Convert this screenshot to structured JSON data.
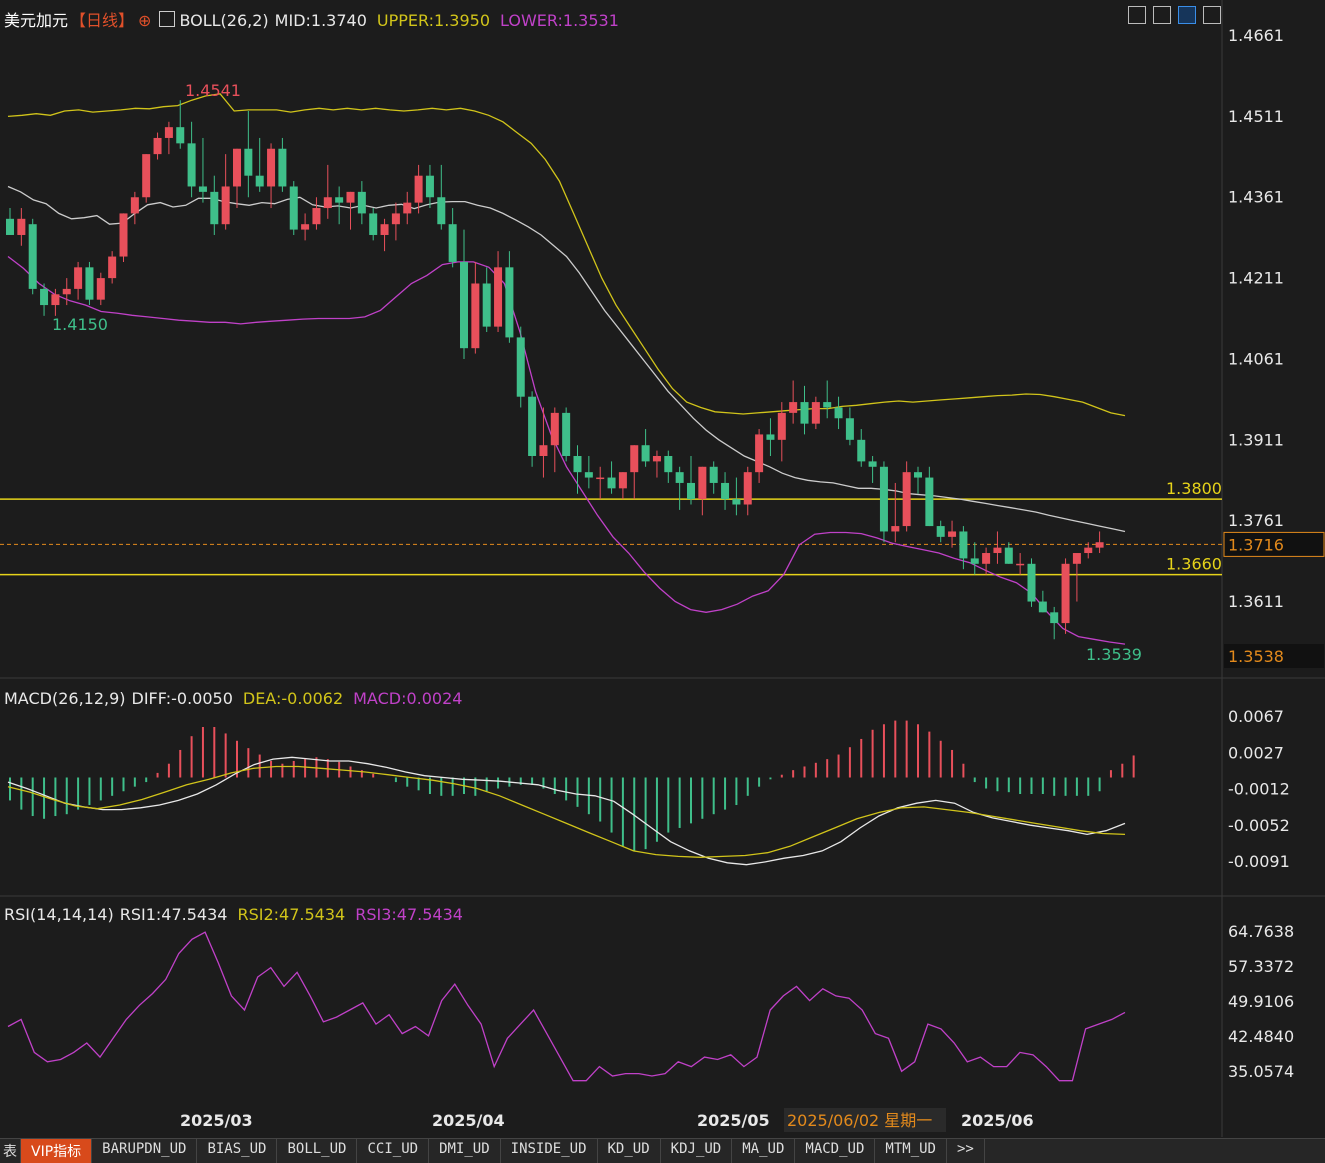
{
  "header": {
    "instrument": "美元加元",
    "period": "【日线】",
    "boll": "BOLL(26,2)",
    "mid": "MID:1.3740",
    "upper": "UPPER:1.3950",
    "lower": "LOWER:1.3531"
  },
  "toolbar_icons": [
    "crosshair-icon",
    "layout-icon",
    "play-icon",
    "forward-icon"
  ],
  "macd_header": {
    "name": "MACD(26,12,9)",
    "diff": "DIFF:-0.0050",
    "dea": "DEA:-0.0062",
    "macd": "MACD:0.0024"
  },
  "rsi_header": {
    "name": "RSI(14,14,14)",
    "rsi1": "RSI1:47.5434",
    "rsi2": "RSI2:47.5434",
    "rsi3": "RSI3:47.5434"
  },
  "colors": {
    "up": "#e8505b",
    "down": "#3fbf8a",
    "mid": "#cccccc",
    "upper": "#d1c41a",
    "lower": "#c041c8",
    "hline": "#e6d31a",
    "price_dash": "#e38a1c",
    "bg": "#1c1c1c"
  },
  "main_axis": {
    "ylim": [
      1.3538,
      1.4661
    ],
    "ticks": [
      "1.4661",
      "1.4511",
      "1.4361",
      "1.4211",
      "1.4061",
      "1.3911",
      "1.3761",
      "1.3611"
    ]
  },
  "macd_axis": {
    "ylim": [
      -0.0091,
      0.0067
    ],
    "ticks": [
      "0.0067",
      "0.0027",
      "-0.0012",
      "-0.0052",
      "-0.0091"
    ]
  },
  "rsi_axis": {
    "ylim": [
      35.0574,
      64.7638
    ],
    "ticks": [
      "64.7638",
      "57.3372",
      "49.9106",
      "42.4840",
      "35.0574"
    ]
  },
  "x_labels": [
    "2025/03",
    "2025/04",
    "2025/05",
    "2025/06"
  ],
  "cursor_date": "2025/06/02 星期一",
  "annotations": {
    "high": "1.4541",
    "low_left": "1.4150",
    "low_right": "1.3539",
    "line_1380": "1.3800",
    "line_1366": "1.3660",
    "current_price": "1.3716",
    "bottom_price": "1.3538"
  },
  "chart_data": {
    "type": "candlestick",
    "x_months": [
      "2025/03",
      "2025/04",
      "2025/05",
      "2025/06"
    ],
    "candles": [
      [
        1.432,
        1.434,
        1.429,
        1.429
      ],
      [
        1.429,
        1.434,
        1.427,
        1.432
      ],
      [
        1.431,
        1.432,
        1.418,
        1.419
      ],
      [
        1.419,
        1.42,
        1.414,
        1.416
      ],
      [
        1.416,
        1.419,
        1.414,
        1.418
      ],
      [
        1.418,
        1.421,
        1.416,
        1.419
      ],
      [
        1.419,
        1.424,
        1.417,
        1.423
      ],
      [
        1.423,
        1.424,
        1.416,
        1.417
      ],
      [
        1.417,
        1.422,
        1.416,
        1.421
      ],
      [
        1.421,
        1.426,
        1.42,
        1.425
      ],
      [
        1.425,
        1.433,
        1.424,
        1.433
      ],
      [
        1.433,
        1.437,
        1.431,
        1.436
      ],
      [
        1.436,
        1.444,
        1.435,
        1.444
      ],
      [
        1.444,
        1.448,
        1.443,
        1.447
      ],
      [
        1.447,
        1.45,
        1.444,
        1.449
      ],
      [
        1.449,
        1.454,
        1.445,
        1.446
      ],
      [
        1.446,
        1.45,
        1.436,
        1.438
      ],
      [
        1.438,
        1.447,
        1.435,
        1.437
      ],
      [
        1.437,
        1.44,
        1.429,
        1.431
      ],
      [
        1.431,
        1.444,
        1.43,
        1.438
      ],
      [
        1.438,
        1.445,
        1.434,
        1.445
      ],
      [
        1.445,
        1.452,
        1.436,
        1.44
      ],
      [
        1.44,
        1.447,
        1.437,
        1.438
      ],
      [
        1.438,
        1.446,
        1.434,
        1.445
      ],
      [
        1.445,
        1.447,
        1.437,
        1.438
      ],
      [
        1.438,
        1.439,
        1.429,
        1.43
      ],
      [
        1.43,
        1.433,
        1.428,
        1.431
      ],
      [
        1.431,
        1.436,
        1.43,
        1.434
      ],
      [
        1.434,
        1.442,
        1.432,
        1.436
      ],
      [
        1.436,
        1.438,
        1.431,
        1.435
      ],
      [
        1.435,
        1.437,
        1.43,
        1.437
      ],
      [
        1.437,
        1.439,
        1.431,
        1.433
      ],
      [
        1.433,
        1.434,
        1.428,
        1.429
      ],
      [
        1.429,
        1.432,
        1.426,
        1.431
      ],
      [
        1.431,
        1.435,
        1.428,
        1.433
      ],
      [
        1.433,
        1.437,
        1.431,
        1.435
      ],
      [
        1.435,
        1.442,
        1.433,
        1.44
      ],
      [
        1.44,
        1.442,
        1.434,
        1.436
      ],
      [
        1.436,
        1.442,
        1.43,
        1.431
      ],
      [
        1.431,
        1.434,
        1.423,
        1.424
      ],
      [
        1.424,
        1.43,
        1.406,
        1.408
      ],
      [
        1.408,
        1.424,
        1.407,
        1.42
      ],
      [
        1.42,
        1.423,
        1.411,
        1.412
      ],
      [
        1.412,
        1.426,
        1.411,
        1.423
      ],
      [
        1.423,
        1.426,
        1.409,
        1.41
      ],
      [
        1.41,
        1.412,
        1.397,
        1.399
      ],
      [
        1.399,
        1.4,
        1.386,
        1.388
      ],
      [
        1.388,
        1.397,
        1.384,
        1.39
      ],
      [
        1.39,
        1.397,
        1.385,
        1.396
      ],
      [
        1.396,
        1.397,
        1.387,
        1.388
      ],
      [
        1.388,
        1.39,
        1.381,
        1.385
      ],
      [
        1.385,
        1.388,
        1.382,
        1.384
      ],
      [
        1.384,
        1.386,
        1.38,
        1.384
      ],
      [
        1.384,
        1.387,
        1.381,
        1.382
      ],
      [
        1.382,
        1.385,
        1.38,
        1.385
      ],
      [
        1.385,
        1.39,
        1.38,
        1.39
      ],
      [
        1.39,
        1.393,
        1.386,
        1.387
      ],
      [
        1.387,
        1.389,
        1.384,
        1.388
      ],
      [
        1.388,
        1.389,
        1.383,
        1.385
      ],
      [
        1.385,
        1.386,
        1.378,
        1.383
      ],
      [
        1.383,
        1.388,
        1.379,
        1.38
      ],
      [
        1.38,
        1.386,
        1.377,
        1.386
      ],
      [
        1.386,
        1.387,
        1.381,
        1.383
      ],
      [
        1.383,
        1.385,
        1.378,
        1.38
      ],
      [
        1.38,
        1.384,
        1.377,
        1.379
      ],
      [
        1.379,
        1.386,
        1.377,
        1.385
      ],
      [
        1.385,
        1.393,
        1.383,
        1.392
      ],
      [
        1.392,
        1.395,
        1.388,
        1.391
      ],
      [
        1.391,
        1.398,
        1.387,
        1.396
      ],
      [
        1.396,
        1.402,
        1.394,
        1.398
      ],
      [
        1.398,
        1.401,
        1.392,
        1.394
      ],
      [
        1.394,
        1.399,
        1.393,
        1.398
      ],
      [
        1.398,
        1.402,
        1.395,
        1.397
      ],
      [
        1.397,
        1.399,
        1.393,
        1.395
      ],
      [
        1.395,
        1.397,
        1.39,
        1.391
      ],
      [
        1.391,
        1.393,
        1.386,
        1.387
      ],
      [
        1.387,
        1.388,
        1.383,
        1.386
      ],
      [
        1.386,
        1.387,
        1.372,
        1.374
      ],
      [
        1.374,
        1.383,
        1.372,
        1.375
      ],
      [
        1.375,
        1.387,
        1.374,
        1.385
      ],
      [
        1.385,
        1.386,
        1.381,
        1.384
      ],
      [
        1.384,
        1.386,
        1.375,
        1.375
      ],
      [
        1.375,
        1.376,
        1.372,
        1.373
      ],
      [
        1.373,
        1.376,
        1.371,
        1.374
      ],
      [
        1.374,
        1.375,
        1.367,
        1.369
      ],
      [
        1.369,
        1.372,
        1.366,
        1.368
      ],
      [
        1.368,
        1.371,
        1.366,
        1.37
      ],
      [
        1.37,
        1.374,
        1.368,
        1.371
      ],
      [
        1.371,
        1.372,
        1.368,
        1.368
      ],
      [
        1.368,
        1.37,
        1.366,
        1.368
      ],
      [
        1.368,
        1.369,
        1.36,
        1.361
      ],
      [
        1.361,
        1.363,
        1.359,
        1.359
      ],
      [
        1.359,
        1.36,
        1.354,
        1.357
      ],
      [
        1.357,
        1.369,
        1.355,
        1.368
      ],
      [
        1.368,
        1.369,
        1.361,
        1.37
      ],
      [
        1.37,
        1.372,
        1.369,
        1.371
      ],
      [
        1.371,
        1.374,
        1.37,
        1.372
      ]
    ],
    "boll_mid": [
      1.438,
      1.437,
      1.4355,
      1.4348,
      1.433,
      1.432,
      1.4322,
      1.4326,
      1.431,
      1.4312,
      1.433,
      1.4346,
      1.435,
      1.4342,
      1.4345,
      1.4358,
      1.4358,
      1.4352,
      1.4348,
      1.4345,
      1.435,
      1.4348,
      1.4356,
      1.436,
      1.4346,
      1.4342,
      1.4344,
      1.434,
      1.4345,
      1.434,
      1.4345,
      1.4347,
      1.4339,
      1.4346,
      1.4351,
      1.4352,
      1.4352,
      1.4345,
      1.434,
      1.433,
      1.4318,
      1.4305,
      1.429,
      1.427,
      1.425,
      1.422,
      1.4185,
      1.415,
      1.412,
      1.409,
      1.406,
      1.403,
      1.4,
      1.3975,
      1.395,
      1.3928,
      1.391,
      1.3895,
      1.388,
      1.387,
      1.386,
      1.3848,
      1.384,
      1.3835,
      1.3832,
      1.383,
      1.3825,
      1.382,
      1.382,
      1.3818,
      1.3815,
      1.381,
      1.3808,
      1.3806,
      1.3803,
      1.38,
      1.3796,
      1.3792,
      1.3788,
      1.3784,
      1.378,
      1.3776,
      1.377,
      1.3765,
      1.376,
      1.3755,
      1.375,
      1.3745,
      1.374
    ],
    "boll_upper": [
      1.451,
      1.4512,
      1.4515,
      1.4512,
      1.452,
      1.4522,
      1.4518,
      1.452,
      1.4522,
      1.4525,
      1.4524,
      1.4528,
      1.453,
      1.454,
      1.4548,
      1.4552,
      1.452,
      1.4522,
      1.4522,
      1.4522,
      1.4518,
      1.4522,
      1.4525,
      1.4522,
      1.4525,
      1.4522,
      1.4525,
      1.4522,
      1.452,
      1.4522,
      1.4525,
      1.4522,
      1.4525,
      1.452,
      1.4512,
      1.45,
      1.448,
      1.446,
      1.443,
      1.439,
      1.433,
      1.427,
      1.421,
      1.416,
      1.412,
      1.408,
      1.404,
      1.4005,
      1.398,
      1.397,
      1.3962,
      1.396,
      1.3958,
      1.396,
      1.3962,
      1.3964,
      1.3966,
      1.3968,
      1.3968,
      1.3972,
      1.3974,
      1.3977,
      1.398,
      1.3982,
      1.398,
      1.3982,
      1.3984,
      1.3986,
      1.3988,
      1.399,
      1.3992,
      1.3993,
      1.3995,
      1.3994,
      1.399,
      1.3985,
      1.398,
      1.397,
      1.396,
      1.3955
    ],
    "boll_lower": [
      1.425,
      1.4228,
      1.42,
      1.418,
      1.4168,
      1.416,
      1.4148,
      1.4145,
      1.4141,
      1.4138,
      1.4135,
      1.4132,
      1.413,
      1.4128,
      1.4128,
      1.4125,
      1.4128,
      1.413,
      1.4132,
      1.4134,
      1.4135,
      1.4135,
      1.4135,
      1.4138,
      1.415,
      1.4175,
      1.42,
      1.4215,
      1.4235,
      1.424,
      1.424,
      1.423,
      1.42,
      1.411,
      1.4,
      1.392,
      1.386,
      1.3815,
      1.377,
      1.373,
      1.37,
      1.3665,
      1.3635,
      1.361,
      1.3595,
      1.359,
      1.3595,
      1.3605,
      1.362,
      1.363,
      1.366,
      1.3715,
      1.3735,
      1.3738,
      1.3738,
      1.3736,
      1.3728,
      1.3718,
      1.3712,
      1.3706,
      1.37,
      1.369,
      1.3682,
      1.3668,
      1.3655,
      1.3645,
      1.3625,
      1.359,
      1.356,
      1.3545,
      1.354,
      1.3535,
      1.3531
    ],
    "macd_hist": [
      -0.0025,
      -0.0035,
      -0.0042,
      -0.0045,
      -0.0042,
      -0.004,
      -0.0035,
      -0.003,
      -0.0025,
      -0.002,
      -0.0015,
      -0.001,
      -0.0005,
      0.0005,
      0.0015,
      0.003,
      0.0045,
      0.0055,
      0.0055,
      0.0048,
      0.004,
      0.0032,
      0.0025,
      0.0018,
      0.0015,
      0.0018,
      0.002,
      0.0022,
      0.002,
      0.0017,
      0.0012,
      0.0008,
      0.0004,
      0.0,
      -0.0005,
      -0.001,
      -0.0014,
      -0.0018,
      -0.002,
      -0.002,
      -0.0018,
      -0.002,
      -0.0015,
      -0.0012,
      -0.001,
      -0.0008,
      -0.0008,
      -0.0012,
      -0.0018,
      -0.0025,
      -0.0032,
      -0.004,
      -0.0048,
      -0.006,
      -0.0075,
      -0.008,
      -0.0078,
      -0.007,
      -0.006,
      -0.0055,
      -0.005,
      -0.0045,
      -0.004,
      -0.0035,
      -0.003,
      -0.002,
      -0.001,
      -0.0002,
      0.0003,
      0.0008,
      0.0012,
      0.0016,
      0.002,
      0.0025,
      0.0033,
      0.0042,
      0.0052,
      0.0058,
      0.0062,
      0.0062,
      0.0058,
      0.005,
      0.004,
      0.003,
      0.0015,
      -0.0005,
      -0.0012,
      -0.0015,
      -0.0016,
      -0.0018,
      -0.0018,
      -0.0018,
      -0.002,
      -0.002,
      -0.002,
      -0.002,
      -0.0015,
      0.0008,
      0.0015,
      0.0024
    ],
    "macd_diff": [
      -0.0005,
      -0.0012,
      -0.002,
      -0.0028,
      -0.0032,
      -0.0035,
      -0.0035,
      -0.0033,
      -0.003,
      -0.0025,
      -0.0018,
      -0.0008,
      0.0004,
      0.0014,
      0.002,
      0.0022,
      0.002,
      0.0018,
      0.0018,
      0.0015,
      0.0011,
      0.0006,
      0.0002,
      0.0,
      -0.0002,
      -0.0003,
      -0.0004,
      -0.0006,
      -0.0008,
      -0.0014,
      -0.0018,
      -0.002,
      -0.0026,
      -0.004,
      -0.0055,
      -0.007,
      -0.008,
      -0.0088,
      -0.0093,
      -0.0095,
      -0.0092,
      -0.0088,
      -0.0085,
      -0.008,
      -0.007,
      -0.0055,
      -0.0042,
      -0.0033,
      -0.0028,
      -0.0025,
      -0.0028,
      -0.0038,
      -0.0044,
      -0.0048,
      -0.0052,
      -0.0055,
      -0.0058,
      -0.0062,
      -0.0058,
      -0.005
    ],
    "macd_dea": [
      -0.001,
      -0.0016,
      -0.0024,
      -0.0031,
      -0.0034,
      -0.003,
      -0.0024,
      -0.0016,
      -0.0008,
      -0.0002,
      0.0005,
      0.001,
      0.0012,
      0.0012,
      0.001,
      0.0008,
      0.0006,
      0.0003,
      0.0,
      -0.0003,
      -0.0007,
      -0.0012,
      -0.002,
      -0.003,
      -0.004,
      -0.005,
      -0.006,
      -0.007,
      -0.008,
      -0.0084,
      -0.0086,
      -0.0087,
      -0.0086,
      -0.0085,
      -0.0082,
      -0.0075,
      -0.0065,
      -0.0055,
      -0.0045,
      -0.0038,
      -0.0033,
      -0.0032,
      -0.0035,
      -0.0038,
      -0.0042,
      -0.0046,
      -0.005,
      -0.0054,
      -0.0058,
      -0.0061,
      -0.0062
    ],
    "rsi": [
      44.5,
      46.0,
      39.0,
      37.0,
      37.5,
      39.0,
      41.0,
      38.0,
      42.0,
      46.0,
      49.0,
      51.5,
      54.5,
      60.0,
      63.0,
      64.5,
      58.0,
      51.0,
      48.0,
      55.0,
      57.0,
      53.0,
      56.0,
      51.0,
      45.5,
      46.5,
      48.0,
      49.5,
      45.0,
      47.0,
      43.0,
      44.5,
      42.5,
      50.0,
      53.5,
      49.0,
      45.0,
      36.0,
      42.0,
      45.0,
      48.0,
      43.0,
      38.0,
      33.0,
      33.0,
      36.0,
      34.0,
      34.5,
      34.5,
      34.0,
      34.5,
      37.0,
      36.0,
      38.0,
      37.5,
      38.5,
      36.0,
      38.0,
      48.0,
      51.0,
      53.0,
      50.0,
      52.5,
      51.0,
      50.5,
      48.0,
      43.0,
      42.0,
      35.0,
      37.0,
      45.0,
      44.0,
      41.0,
      37.0,
      38.0,
      36.0,
      36.0,
      39.0,
      38.5,
      36.0,
      33.0,
      33.0,
      44.0,
      45.0,
      46.0,
      47.5
    ],
    "ylim": [
      1.3538,
      1.4661
    ]
  }
}
